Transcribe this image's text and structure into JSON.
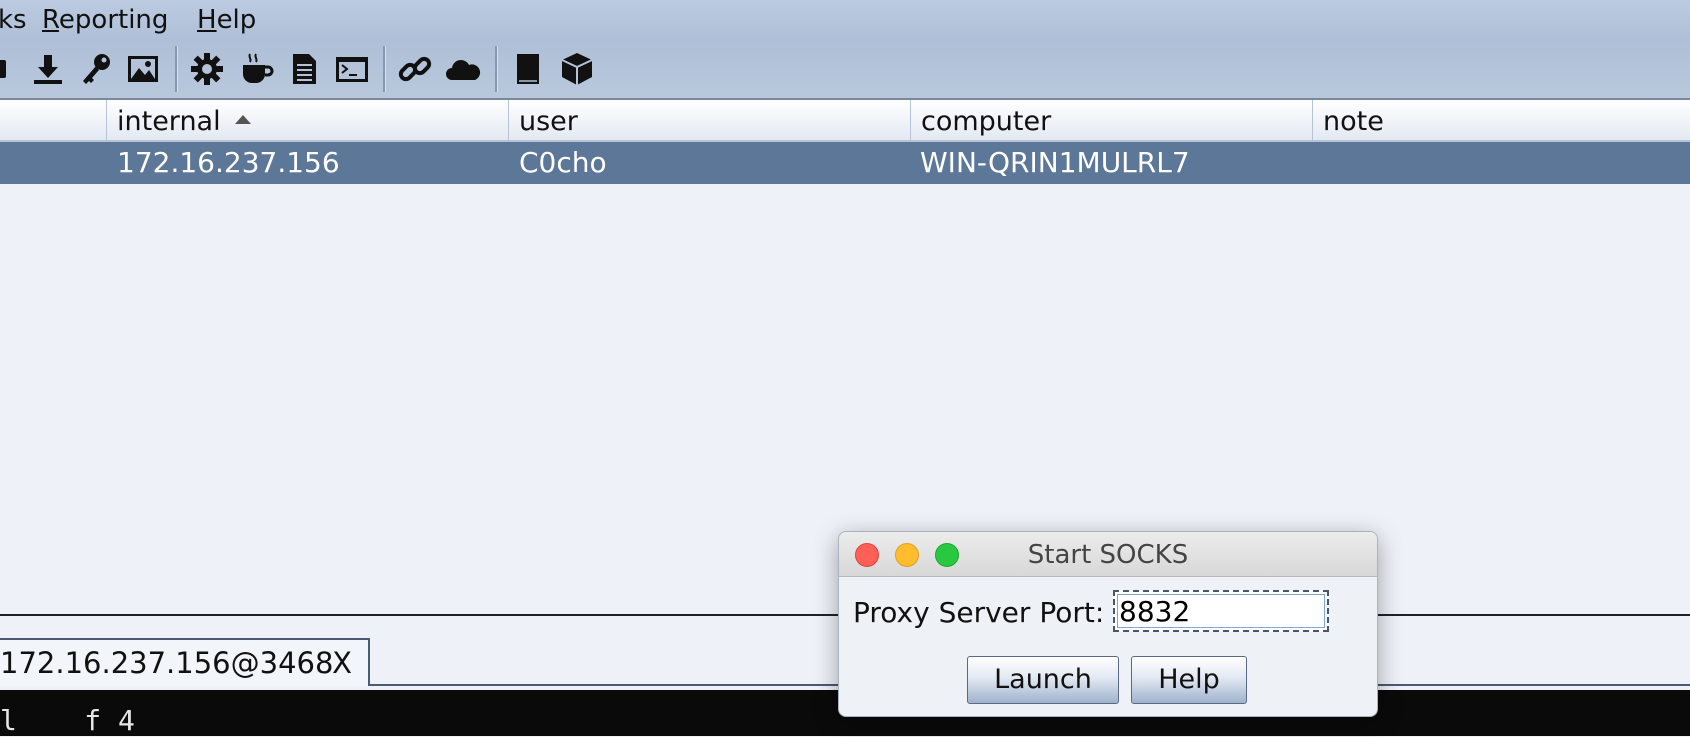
{
  "menu": {
    "items": [
      {
        "prefix": "",
        "mnemonic": "",
        "rest": "ks"
      },
      {
        "prefix": "",
        "mnemonic": "R",
        "rest": "eporting"
      },
      {
        "prefix": "",
        "mnemonic": "H",
        "rest": "elp"
      }
    ]
  },
  "toolbar": {
    "icons": [
      "stop-icon",
      "download-icon",
      "key-icon",
      "screenshot-icon",
      "gear-icon",
      "coffee-cup-icon",
      "document-icon",
      "terminal-icon",
      "link-icon",
      "cloud-icon",
      "book-icon",
      "package-icon"
    ]
  },
  "table": {
    "columns": {
      "internal": "internal",
      "user": "user",
      "computer": "computer",
      "note": "note"
    },
    "sorted_column": "internal",
    "rows": [
      {
        "internal": "172.16.237.156",
        "user": "C0cho",
        "computer": "WIN-QRIN1MULRL7",
        "note": ""
      }
    ]
  },
  "tabs": [
    {
      "label": "172.16.237.156@3468",
      "close": "X"
    }
  ],
  "console": {
    "visible_text": "l    f 4"
  },
  "dialog": {
    "title": "Start SOCKS",
    "port_label": "Proxy Server Port:",
    "port_value": "8832",
    "launch_label": "Launch",
    "help_label": "Help"
  },
  "colors": {
    "selected_row": "#5c7797",
    "menubar": "#aebfd7",
    "console_bg": "#0a0a0a"
  }
}
